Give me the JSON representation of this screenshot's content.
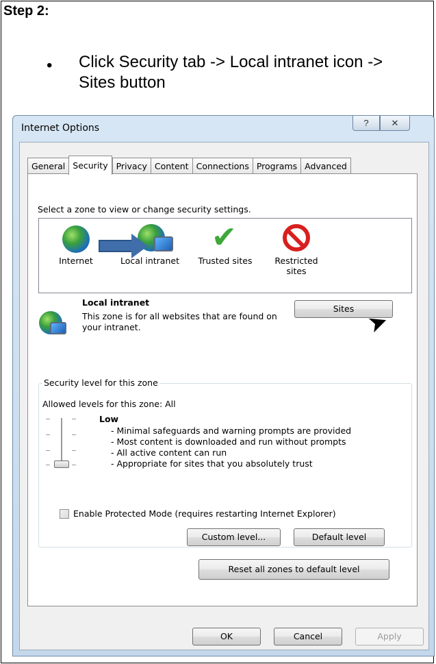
{
  "doc": {
    "step_title": "Step 2:",
    "instruction": "Click Security tab -> Local intranet icon -> Sites button"
  },
  "dialog": {
    "title": "Internet Options",
    "help_label": "?",
    "close_label": "✕",
    "tabs": [
      "General",
      "Security",
      "Privacy",
      "Content",
      "Connections",
      "Programs",
      "Advanced"
    ],
    "active_tab": "Security",
    "zone_prompt": "Select a zone to view or change security settings.",
    "zones": [
      {
        "name": "Internet",
        "icon": "globe-icon"
      },
      {
        "name": "Local intranet",
        "icon": "local-intranet-icon"
      },
      {
        "name": "Trusted sites",
        "icon": "checkmark-icon"
      },
      {
        "name": "Restricted sites",
        "icon": "prohibited-icon"
      }
    ],
    "zone_detail": {
      "title": "Local intranet",
      "description": "This zone is for all websites that are found on your intranet.",
      "sites_button": "Sites"
    },
    "security_level": {
      "group_label": "Security level for this zone",
      "allowed_levels": "Allowed levels for this zone: All",
      "level_name": "Low",
      "level_points": [
        "- Minimal safeguards and warning prompts are provided",
        "- Most content is downloaded and run without prompts",
        "- All active content can run",
        "- Appropriate for sites that you absolutely trust"
      ],
      "protected_mode_label": "Enable Protected Mode (requires restarting Internet Explorer)",
      "protected_mode_checked": false,
      "custom_level_button": "Custom level...",
      "default_level_button": "Default level"
    },
    "reset_button": "Reset all zones to default level",
    "ok_button": "OK",
    "cancel_button": "Cancel",
    "apply_button": "Apply"
  },
  "colors": {
    "arrow": "#3f6eaa",
    "dialog_frame": "#c4d8ec"
  }
}
